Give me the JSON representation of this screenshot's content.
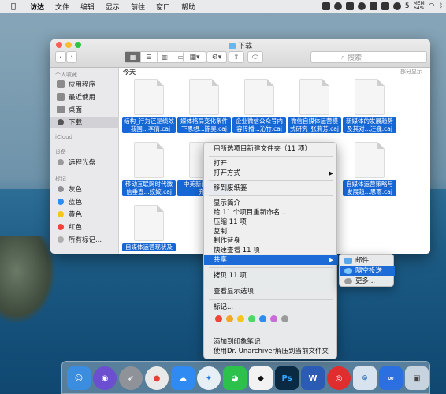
{
  "menubar": {
    "app": "访达",
    "items": [
      "文件",
      "编辑",
      "显示",
      "前往",
      "窗口",
      "帮助"
    ],
    "status_icons": [
      "dropbox-icon",
      "music-icon",
      "status-app-icon",
      "baidu-icon",
      "status-icon-2",
      "grid-icon",
      "wechat-icon",
      "moon-icon",
      "wifi-icon",
      "volume-icon"
    ],
    "battery_count": "5",
    "mem_top": "MEM",
    "mem_bottom": "64%"
  },
  "window": {
    "title": "下载",
    "search_placeholder": "搜索",
    "toolbar": {
      "back": "‹",
      "forward": "›",
      "views": [
        "▦",
        "☰",
        "▥",
        "▭"
      ],
      "arrange": "▦▾",
      "action": "⚙▾",
      "share": "⇧",
      "tags": "⬭"
    }
  },
  "sidebar": {
    "favorites_header": "个人收藏",
    "favorites": [
      "应用程序",
      "最近使用",
      "桌面",
      "下载"
    ],
    "icloud_header": "iCloud",
    "devices_header": "设备",
    "devices": [
      "远程光盘"
    ],
    "tags_header": "标记",
    "tags": [
      {
        "label": "灰色",
        "color": "#8e8e93"
      },
      {
        "label": "蓝色",
        "color": "#2e8cf0"
      },
      {
        "label": "黄色",
        "color": "#f5c518"
      },
      {
        "label": "红色",
        "color": "#f04438"
      },
      {
        "label": "所有标记...",
        "color": "#b0b0b0"
      }
    ]
  },
  "content": {
    "section_label": "今天",
    "show_less": "部分显示",
    "files": [
      {
        "name": "结构_行为还是绩效_我国...李倩.caj"
      },
      {
        "name": "媒体格局变化条件下思想...陈昊.caj"
      },
      {
        "name": "企业微信公众号内容传播...沁竹.caj"
      },
      {
        "name": "微信自媒体运营模式研究_张莉芳.caj"
      },
      {
        "name": "新媒体的发展趋势及其对...汪巍.caj"
      },
      {
        "name": "移动互联网时代微信垂直...姣姣.caj"
      },
      {
        "name": "中美新闻...较研究..."
      },
      {
        "name": "自媒体运营策略与发展趋...思雨.caj"
      },
      {
        "name": "自媒体运营现状及"
      }
    ]
  },
  "context_menu": {
    "items": {
      "new_folder": "用所选项目新建文件夹（11 项）",
      "open": "打开",
      "open_with": "打开方式",
      "trash": "移到废纸篓",
      "get_info": "显示简介",
      "rename": "给 11 个项目重新命名...",
      "compress": "压缩 11 项",
      "duplicate": "复制",
      "alias": "制作替身",
      "quicklook": "快速查看 11 项",
      "share": "共享",
      "copy": "拷贝 11 项",
      "view_options": "查看显示选项",
      "tags": "标记...",
      "evernote": "添加到印象笔记",
      "unarchiver": "使用Dr. Unarchiver解压到当前文件夹"
    },
    "tag_colors": [
      "#f04438",
      "#f5a623",
      "#f5c518",
      "#4cd964",
      "#2e8cf0",
      "#c86dd7",
      "#9b9b9b"
    ]
  },
  "share_submenu": {
    "items": [
      "邮件",
      "隔空投送",
      "更多..."
    ]
  },
  "dock": {
    "apps": [
      {
        "name": "finder",
        "color": "#3b8de0",
        "glyph": "☺"
      },
      {
        "name": "siri",
        "color": "#6b4fd0",
        "glyph": "◉"
      },
      {
        "name": "launchpad",
        "color": "#8f9399",
        "glyph": "➶"
      },
      {
        "name": "chrome",
        "color": "#e9e9e9",
        "glyph": "●"
      },
      {
        "name": "baidu-netdisk",
        "color": "#2f8bf2",
        "glyph": "☁"
      },
      {
        "name": "safari",
        "color": "#e6eef6",
        "glyph": "✦"
      },
      {
        "name": "wechat",
        "color": "#2cc14a",
        "glyph": "◕"
      },
      {
        "name": "qq",
        "color": "#f2f2f2",
        "glyph": "◆"
      },
      {
        "name": "photoshop",
        "color": "#0a2a43",
        "glyph": "Ps"
      },
      {
        "name": "word",
        "color": "#2b5bb5",
        "glyph": "W"
      },
      {
        "name": "netease-music",
        "color": "#e02d2d",
        "glyph": "◎"
      },
      {
        "name": "network-app",
        "color": "#d7e3ee",
        "glyph": "⌾"
      },
      {
        "name": "baidu-app",
        "color": "#2c6fe0",
        "glyph": "∞"
      },
      {
        "name": "app-store-like",
        "color": "#c7d4e0",
        "glyph": "▣"
      }
    ]
  }
}
